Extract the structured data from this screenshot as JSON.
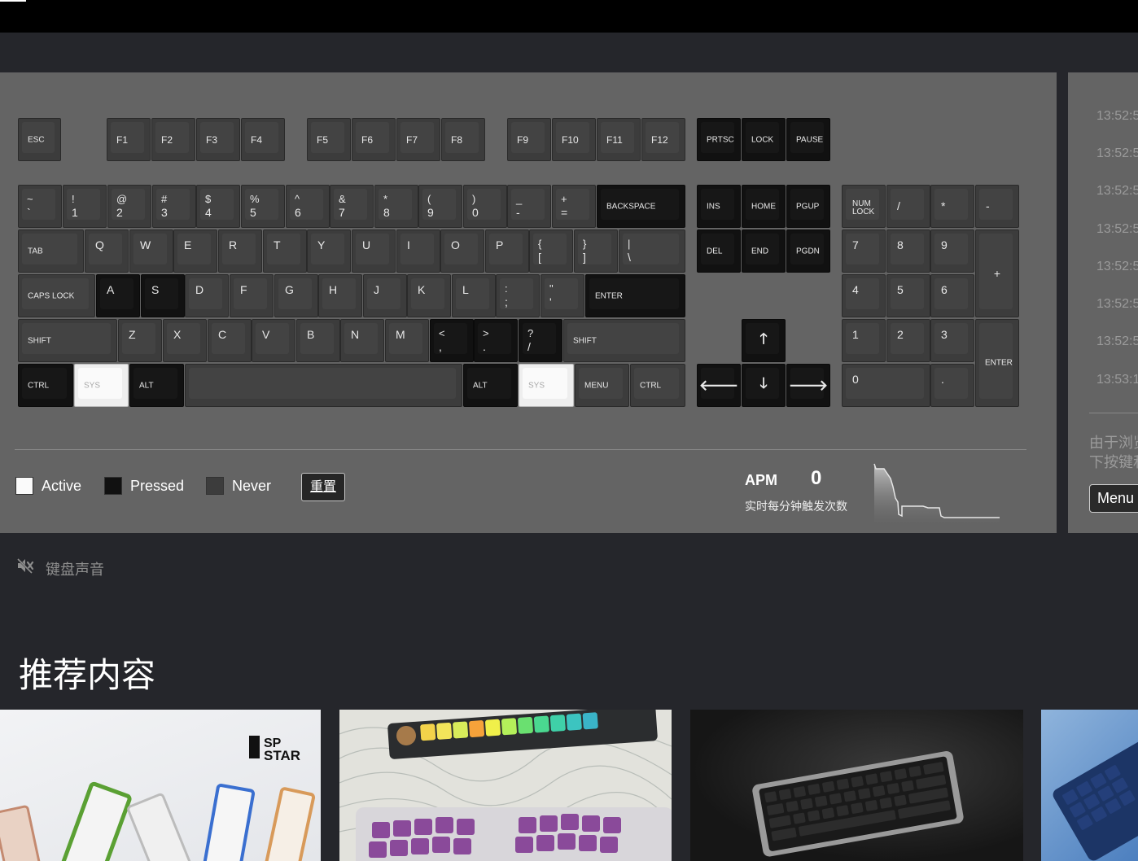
{
  "keyboard": {
    "function_row": {
      "esc": "ESC",
      "f1": "F1",
      "f2": "F2",
      "f3": "F3",
      "f4": "F4",
      "f5": "F5",
      "f6": "F6",
      "f7": "F7",
      "f8": "F8",
      "f9": "F9",
      "f10": "F10",
      "f11": "F11",
      "f12": "F12",
      "prtsc": "PRTSC",
      "lock": "LOCK",
      "pause": "PAUSE"
    },
    "number_row": [
      {
        "top": "~",
        "bot": "`"
      },
      {
        "top": "!",
        "bot": "1"
      },
      {
        "top": "@",
        "bot": "2"
      },
      {
        "top": "#",
        "bot": "3"
      },
      {
        "top": "$",
        "bot": "4"
      },
      {
        "top": "%",
        "bot": "5"
      },
      {
        "top": "^",
        "bot": "6"
      },
      {
        "top": "&",
        "bot": "7"
      },
      {
        "top": "*",
        "bot": "8"
      },
      {
        "top": "(",
        "bot": "9"
      },
      {
        "top": ")",
        "bot": "0"
      },
      {
        "top": "_",
        "bot": "-"
      },
      {
        "top": "+",
        "bot": "="
      }
    ],
    "backspace": "BACKSPACE",
    "tab": "TAB",
    "qrow": [
      "Q",
      "W",
      "E",
      "R",
      "T",
      "Y",
      "U",
      "I",
      "O",
      "P"
    ],
    "qrow_sym": [
      {
        "top": "{",
        "bot": "["
      },
      {
        "top": "}",
        "bot": "]"
      },
      {
        "top": "|",
        "bot": "\\"
      }
    ],
    "caps": "CAPS LOCK",
    "arow": [
      "A",
      "S",
      "D",
      "F",
      "G",
      "H",
      "J",
      "K",
      "L"
    ],
    "arow_sym": [
      {
        "top": ":",
        "bot": ";"
      },
      {
        "top": "\"",
        "bot": "'"
      }
    ],
    "enter": "ENTER",
    "shift": "SHIFT",
    "zrow": [
      "Z",
      "X",
      "C",
      "V",
      "B",
      "N",
      "M"
    ],
    "zrow_sym": [
      {
        "top": "<",
        "bot": ","
      },
      {
        "top": ">",
        "bot": "."
      },
      {
        "top": "?",
        "bot": "/"
      }
    ],
    "ctrl": "CTRL",
    "sys": "SYS",
    "alt": "ALT",
    "menu": "MENU",
    "nav": {
      "ins": "INS",
      "home": "HOME",
      "pgup": "PGUP",
      "del": "DEL",
      "end": "END",
      "pgdn": "PGDN",
      "up": "🡑",
      "left": "🡐",
      "down": "🡓",
      "right": "🡒"
    },
    "numpad": {
      "numlock": "NUM LOCK",
      "slash": "/",
      "star": "*",
      "minus": "-",
      "n7": "7",
      "n8": "8",
      "n9": "9",
      "plus": "+",
      "n4": "4",
      "n5": "5",
      "n6": "6",
      "n1": "1",
      "n2": "2",
      "n3": "3",
      "enter": "ENTER",
      "n0": "0",
      "dot": "."
    }
  },
  "legend": {
    "active": "Active",
    "pressed": "Pressed",
    "never": "Never",
    "reset": "重置"
  },
  "apm": {
    "label": "APM",
    "value": "0",
    "subtitle": "实时每分钟触发次数"
  },
  "side": {
    "times": [
      "13:52:5",
      "13:52:5",
      "13:52:5",
      "13:52:5",
      "13:52:5",
      "13:52:5",
      "13:52:5",
      "13:53:1"
    ],
    "note_line1": "由于浏览",
    "note_line2": "下按键和",
    "menu": "Menu"
  },
  "sound": {
    "label": "键盘声音",
    "icon": "speaker-muted-icon"
  },
  "recommend": {
    "title": "推荐内容",
    "brand": "SP STAR"
  },
  "colors": {
    "page_bg": "#25262b",
    "panel_bg": "#646464",
    "key_bg": "#3c3c3c",
    "key_pressed": "#111111",
    "key_active": "#eeeeee"
  }
}
